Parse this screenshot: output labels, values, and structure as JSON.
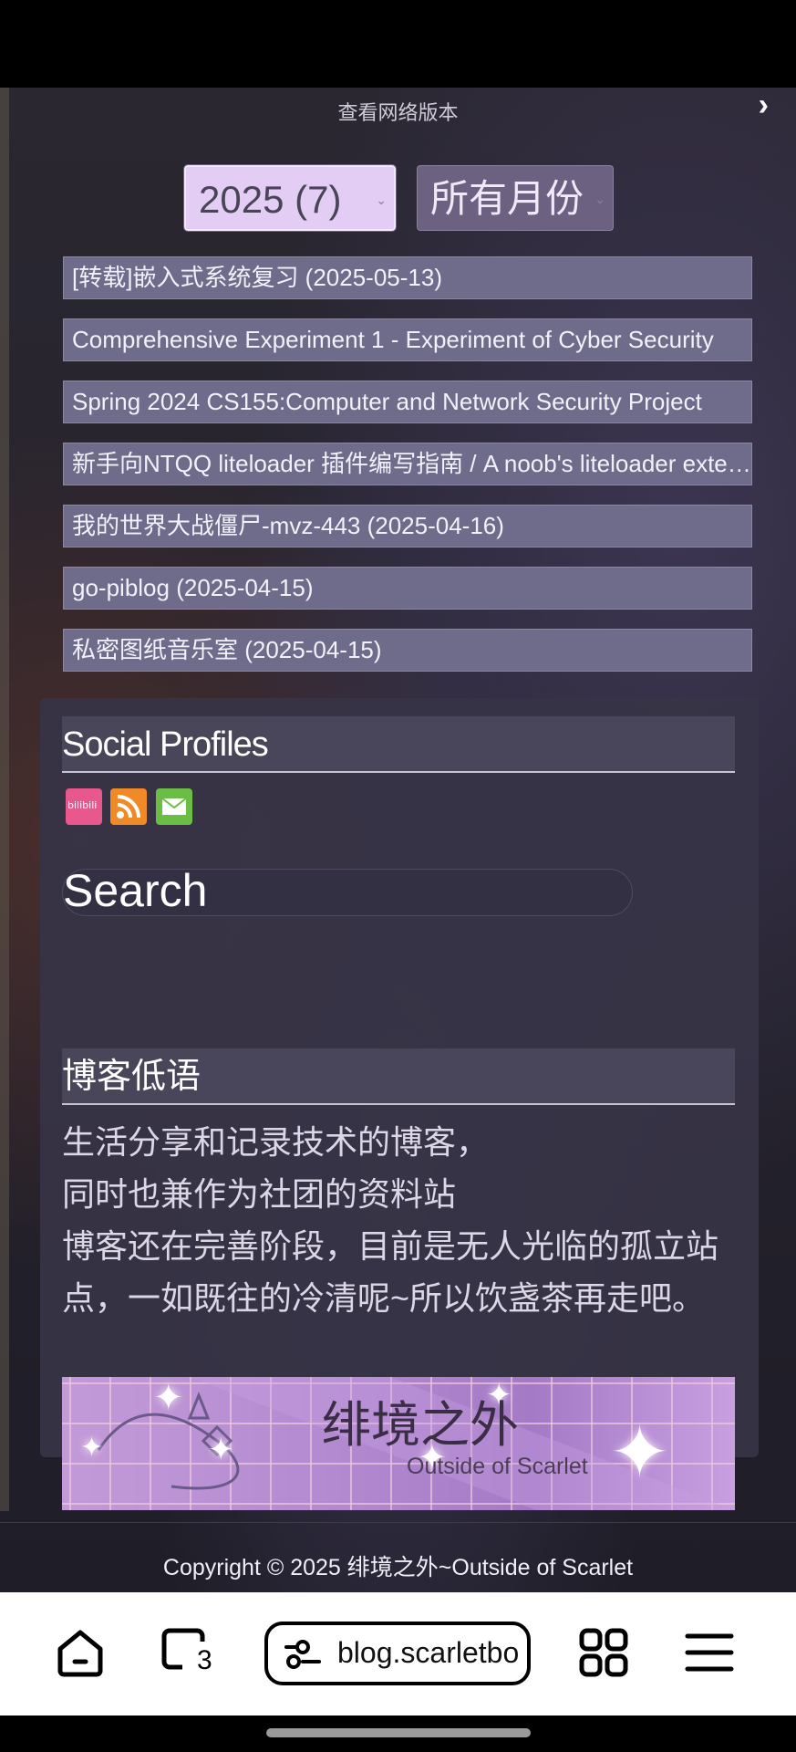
{
  "header": {
    "view_web_label": "查看网络版本",
    "next_arrow": "›"
  },
  "archive": {
    "year_select": "2025 (7)",
    "month_select": "所有月份"
  },
  "posts": [
    "[转载]嵌入式系统复习 (2025-05-13)",
    "Comprehensive Experiment 1 - Experiment of Cyber Security",
    "Spring 2024 CS155:Computer and Network Security Project",
    "新手向NTQQ liteloader 插件编写指南 / A noob's liteloader extension guide",
    "我的世界大战僵尸-mvz-443 (2025-04-16)",
    "go-piblog (2025-04-15)",
    "私密图纸音乐室 (2025-04-15)"
  ],
  "sidebar": {
    "social_title": "Social Profiles",
    "social_icons": [
      "bilibili-icon",
      "rss-icon",
      "mail-icon"
    ],
    "bilibili_text": "bilibili",
    "search_placeholder": "Search",
    "blog_title": "博客低语",
    "about_lines": [
      "生活分享和记录技术的博客，",
      "同时也兼作为社团的资料站",
      "博客还在完善阶段，目前是无人光临的孤立站点，一如既往的冷清呢~所以饮盏茶再走吧。"
    ],
    "banner_cn": "绯境之外",
    "banner_en": "Outside of Scarlet"
  },
  "footer": {
    "copyright": "Copyright © 2025 绯境之外~Outside of Scarlet"
  },
  "browser": {
    "url": "blog.scarletbo",
    "tab_count": "3",
    "icons": [
      "home-icon",
      "tabs-icon",
      "site-settings-icon",
      "apps-grid-icon",
      "menu-icon"
    ]
  },
  "colors": {
    "post_bg": "#6e6c8a",
    "year_select_bg": "#e4cdf5",
    "sidebar_bg": "#373446"
  }
}
